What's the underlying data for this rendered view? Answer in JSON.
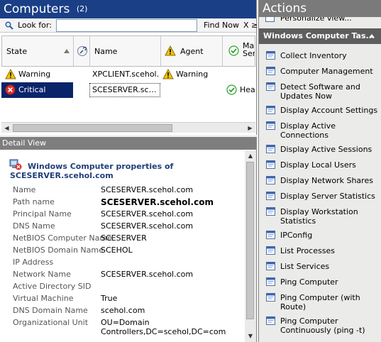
{
  "computers": {
    "title": "Computers",
    "count": "(2)",
    "lookfor_label": "Look for:",
    "lookfor_value": "",
    "find_now": "Find Now",
    "clear": "X",
    "more": "≥",
    "columns": {
      "state": "State",
      "name": "Name",
      "agent": "Agent",
      "mgmt": "Man Serv"
    },
    "rows": [
      {
        "state": "Warning",
        "name": "XPCLIENT.scehol.com",
        "agent": "Warning",
        "mgmt": ""
      },
      {
        "state": "Critical",
        "name": "SCESERVER.scehol.com",
        "agent": "",
        "mgmt": "Healthy"
      }
    ]
  },
  "detail": {
    "header": "Detail View",
    "title": "Windows Computer properties of SCESERVER.scehol.com",
    "properties": [
      {
        "key": "Name",
        "value": "SCESERVER.scehol.com"
      },
      {
        "key": "Path name",
        "value": "SCESERVER.scehol.com"
      },
      {
        "key": "Principal Name",
        "value": "SCESERVER.scehol.com"
      },
      {
        "key": "DNS Name",
        "value": "SCESERVER.scehol.com"
      },
      {
        "key": "NetBIOS Computer Name",
        "value": "SCESERVER"
      },
      {
        "key": "NetBIOS Domain Name",
        "value": "SCEHOL"
      },
      {
        "key": "IP Address",
        "value": ""
      },
      {
        "key": "Network Name",
        "value": "SCESERVER.scehol.com"
      },
      {
        "key": "Active Directory SID",
        "value": ""
      },
      {
        "key": "Virtual Machine",
        "value": "True"
      },
      {
        "key": "DNS Domain Name",
        "value": "scehol.com"
      },
      {
        "key": "Organizational Unit",
        "value": "OU=Domain Controllers,DC=scehol,DC=com"
      }
    ]
  },
  "actions": {
    "title": "Actions",
    "personalize": "Personalize view...",
    "section_title": "Windows Computer Tas...",
    "items": [
      {
        "label": "Collect Inventory"
      },
      {
        "label": "Computer Management"
      },
      {
        "label": "Detect Software and Updates Now"
      },
      {
        "label": "Display Account Settings"
      },
      {
        "label": "Display Active Connections"
      },
      {
        "label": "Display Active Sessions"
      },
      {
        "label": "Display Local Users"
      },
      {
        "label": "Display Network Shares"
      },
      {
        "label": "Display Server Statistics"
      },
      {
        "label": "Display Workstation Statistics"
      },
      {
        "label": "IPConfig"
      },
      {
        "label": "List Processes"
      },
      {
        "label": "List Services"
      },
      {
        "label": "Ping Computer"
      },
      {
        "label": "Ping Computer (with Route)"
      },
      {
        "label": "Ping Computer Continuously (ping -t)"
      }
    ]
  },
  "colors": {
    "header_blue": "#1a3f86",
    "selection": "#0a246a",
    "warning": "#f5c400",
    "critical": "#d9302c",
    "healthy": "#2f9e2f"
  }
}
